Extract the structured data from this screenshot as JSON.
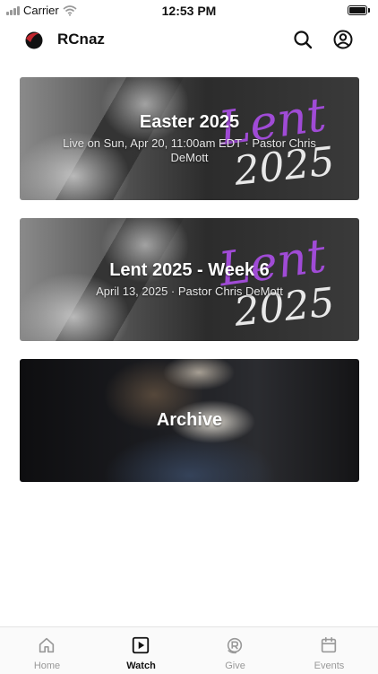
{
  "status_bar": {
    "carrier": "Carrier",
    "time": "12:53 PM"
  },
  "header": {
    "app_name": "RCnaz",
    "search_icon": "search-icon",
    "account_icon": "user-circle-icon"
  },
  "cards": [
    {
      "title": "Easter 2025",
      "subtitle": "Live on Sun, Apr 20, 11:00am EDT · Pastor Chris DeMott",
      "art_line1": "Lent",
      "art_line2": "2025"
    },
    {
      "title": "Lent 2025 - Week 6",
      "subtitle": "April 13, 2025 · Pastor Chris DeMott",
      "art_line1": "Lent",
      "art_line2": "2025"
    },
    {
      "title": "Archive",
      "subtitle": ""
    }
  ],
  "tabs": [
    {
      "label": "Home",
      "icon": "home-icon"
    },
    {
      "label": "Watch",
      "icon": "play-icon",
      "active": true
    },
    {
      "label": "Give",
      "icon": "give-icon"
    },
    {
      "label": "Events",
      "icon": "calendar-icon"
    }
  ],
  "colors": {
    "accent_purple": "#a04bd6",
    "logo_red": "#c0262e"
  }
}
